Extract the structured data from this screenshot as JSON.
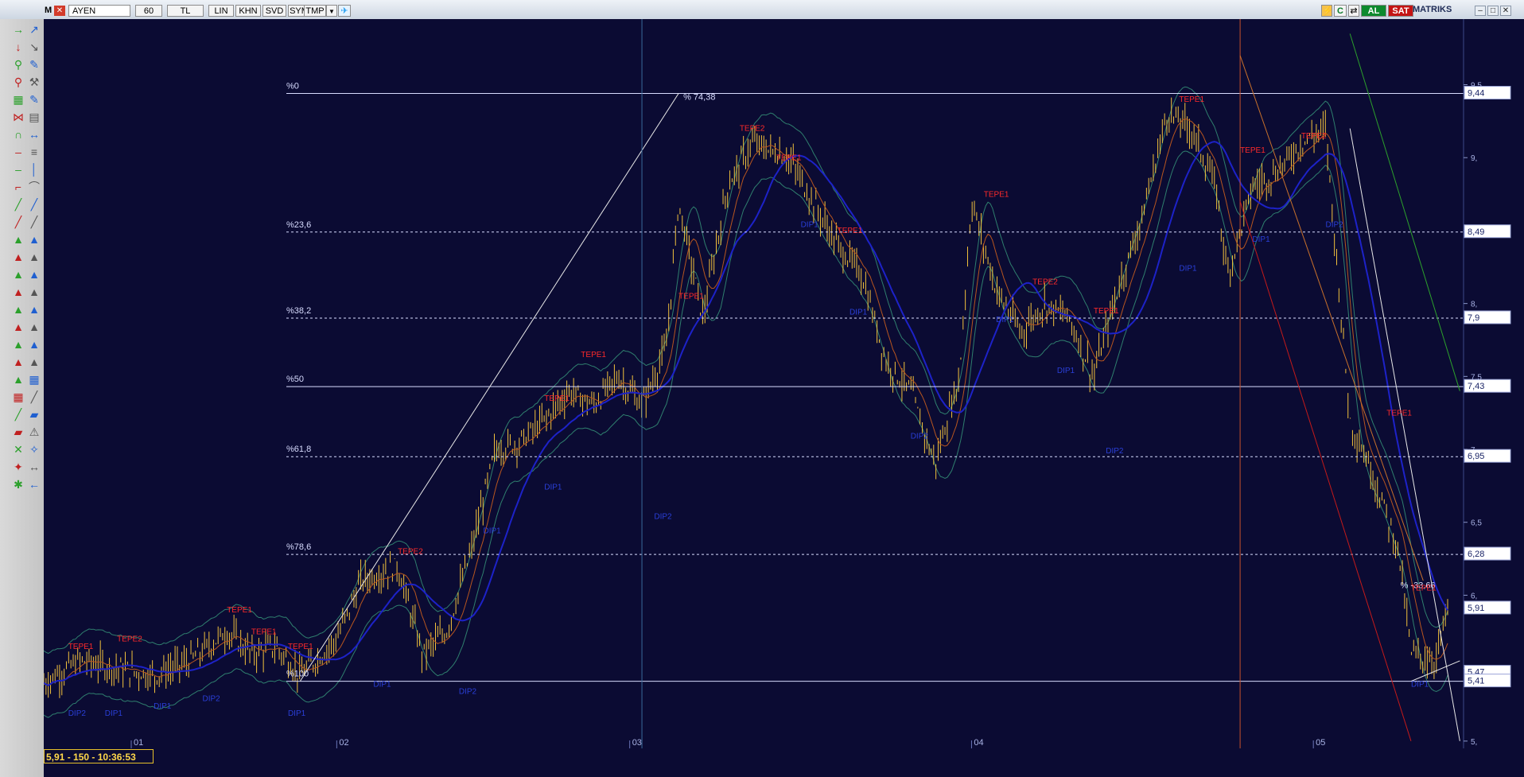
{
  "toolbar": {
    "app_logo": "M",
    "symbol": "AYEN",
    "period": "60",
    "currency": "TL",
    "buttons": [
      "LIN",
      "KHN",
      "SVD",
      "SYM",
      "TMP"
    ],
    "right": {
      "c_label": "C",
      "buy_label": "AL",
      "sell_label": "SAT",
      "brand": "MATRIKS"
    }
  },
  "status": {
    "text": "5,91 - 150 - 10:36:53"
  },
  "colors": {
    "background": "#0b0b33",
    "candles": "#f3c23c",
    "ma_blue": "#1d22c8",
    "ma_orange": "#b8561f",
    "band": "#2f7f6e",
    "level_line": "#d8dcff",
    "peak_label": "#ff2a2a",
    "trough_label": "#2a3fd8",
    "price_box": "#ffffff"
  },
  "chart_data": {
    "type": "candlestick",
    "symbol": "AYEN",
    "interval": "60",
    "x_tick_labels": [
      "01",
      "02",
      "03",
      "04",
      "05"
    ],
    "y_tick_labels": [
      "9,5",
      "9,",
      "8,5",
      "8,",
      "7,5",
      "7,",
      "6,5",
      "6,",
      "5,5",
      "5,"
    ],
    "ylim": [
      4.95,
      9.95
    ],
    "price_boxes": [
      "9,44",
      "8,49",
      "7,9",
      "7,43",
      "6,95",
      "6,28",
      "5,91",
      "5,47",
      "5,41"
    ],
    "fibonacci_levels": [
      {
        "label": "%0",
        "value": 9.44,
        "style": "solid"
      },
      {
        "label": "%23,6",
        "value": 8.49,
        "style": "dashed"
      },
      {
        "label": "%38,2",
        "value": 7.9,
        "style": "dashed"
      },
      {
        "label": "%50",
        "value": 7.43,
        "style": "solid"
      },
      {
        "label": "%61,8",
        "value": 6.95,
        "style": "dashed"
      },
      {
        "label": "%78,6",
        "value": 6.28,
        "style": "dashed"
      },
      {
        "label": "%100",
        "value": 5.41,
        "style": "solid"
      }
    ],
    "annotations": [
      "% 74,38",
      "% -33,66"
    ],
    "peak_label": "TEPE1",
    "peak2_label": "TEPE2",
    "trough_label": "DIP1",
    "trough2_label": "DIP2",
    "price_series": [
      {
        "x": 0,
        "close": 5.4
      },
      {
        "x": 3,
        "close": 5.55
      },
      {
        "x": 6,
        "close": 5.5
      },
      {
        "x": 9,
        "close": 5.45
      },
      {
        "x": 12,
        "close": 5.55
      },
      {
        "x": 15,
        "close": 5.75
      },
      {
        "x": 17,
        "close": 5.6
      },
      {
        "x": 19,
        "close": 5.65
      },
      {
        "x": 21,
        "close": 5.45
      },
      {
        "x": 24,
        "close": 5.7
      },
      {
        "x": 26,
        "close": 6.1
      },
      {
        "x": 29,
        "close": 6.2
      },
      {
        "x": 31,
        "close": 5.6
      },
      {
        "x": 33,
        "close": 5.75
      },
      {
        "x": 35,
        "close": 6.3
      },
      {
        "x": 37,
        "close": 7.0
      },
      {
        "x": 39,
        "close": 7.05
      },
      {
        "x": 41,
        "close": 7.2
      },
      {
        "x": 43,
        "close": 7.4
      },
      {
        "x": 45,
        "close": 7.3
      },
      {
        "x": 47,
        "close": 7.5
      },
      {
        "x": 49,
        "close": 7.3
      },
      {
        "x": 51,
        "close": 7.7
      },
      {
        "x": 52,
        "close": 8.7
      },
      {
        "x": 54,
        "close": 7.9
      },
      {
        "x": 56,
        "close": 8.8
      },
      {
        "x": 58,
        "close": 9.1
      },
      {
        "x": 61,
        "close": 9.0
      },
      {
        "x": 63,
        "close": 8.7
      },
      {
        "x": 65,
        "close": 8.4
      },
      {
        "x": 67,
        "close": 8.2
      },
      {
        "x": 69,
        "close": 7.6
      },
      {
        "x": 71,
        "close": 7.4
      },
      {
        "x": 73,
        "close": 6.9
      },
      {
        "x": 75,
        "close": 7.5
      },
      {
        "x": 76,
        "close": 8.7
      },
      {
        "x": 78,
        "close": 8.1
      },
      {
        "x": 80,
        "close": 7.8
      },
      {
        "x": 82,
        "close": 8.0
      },
      {
        "x": 84,
        "close": 7.9
      },
      {
        "x": 86,
        "close": 7.5
      },
      {
        "x": 88,
        "close": 8.1
      },
      {
        "x": 90,
        "close": 8.6
      },
      {
        "x": 92,
        "close": 9.3
      },
      {
        "x": 94,
        "close": 9.2
      },
      {
        "x": 96,
        "close": 8.8
      },
      {
        "x": 97,
        "close": 8.2
      },
      {
        "x": 99,
        "close": 8.8
      },
      {
        "x": 101,
        "close": 8.9
      },
      {
        "x": 103,
        "close": 9.1
      },
      {
        "x": 105,
        "close": 9.2
      },
      {
        "x": 107,
        "close": 7.2
      },
      {
        "x": 109,
        "close": 6.8
      },
      {
        "x": 111,
        "close": 6.3
      },
      {
        "x": 112,
        "close": 5.6
      },
      {
        "x": 114,
        "close": 5.55
      },
      {
        "x": 115,
        "close": 5.91
      }
    ]
  }
}
